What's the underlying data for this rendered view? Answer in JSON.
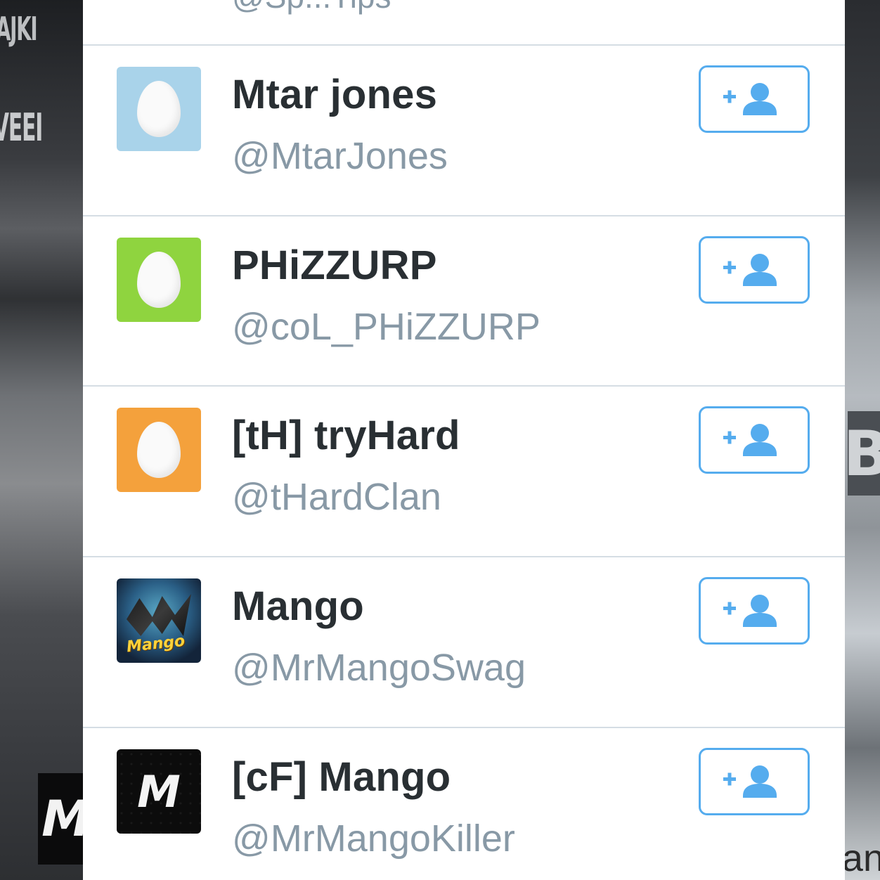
{
  "background": {
    "top_left_text": "AJKI",
    "mid_left_text": "VEEI",
    "bottom_left_box": "M",
    "bottom_right_text": "an",
    "right_block_text": "B"
  },
  "partial_row": {
    "handle": "@Sp...Tips"
  },
  "users": [
    {
      "name": "Mtar jones",
      "handle": "@MtarJones",
      "avatar": "egg",
      "avatar_color": "#a9d3ea"
    },
    {
      "name": "PHiZZURP",
      "handle": "@coL_PHiZZURP",
      "avatar": "egg",
      "avatar_color": "#8fd43f"
    },
    {
      "name": "[tH] tryHard",
      "handle": "@tHardClan",
      "avatar": "egg",
      "avatar_color": "#f4a13c"
    },
    {
      "name": "Mango",
      "handle": "@MrMangoSwag",
      "avatar": "mango-logo",
      "avatar_label": "Mango"
    },
    {
      "name": "[cF] Mango",
      "handle": "@MrMangoKiller",
      "avatar": "cf-logo",
      "avatar_label": "M"
    }
  ],
  "follow_button": {
    "icon": "follow-user-plus-icon",
    "color": "#55acee"
  },
  "colors": {
    "name": "#292f33",
    "handle": "#8899a6",
    "divider": "#d5dde4"
  }
}
